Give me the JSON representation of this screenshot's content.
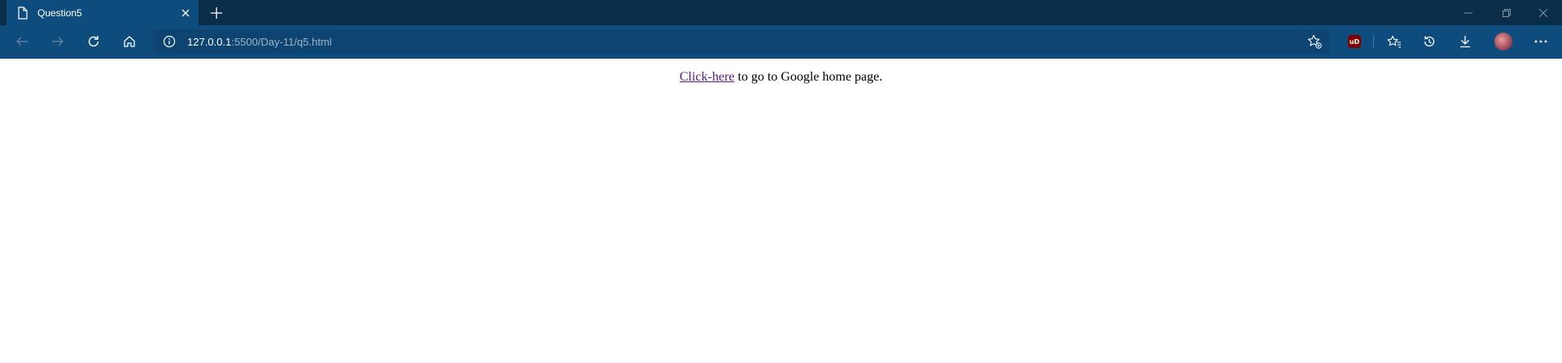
{
  "tab": {
    "title": "Question5",
    "favicon": "page-icon",
    "close": "close-icon"
  },
  "new_tab": "plus-icon",
  "window_controls": [
    "minimize-icon",
    "restore-icon",
    "close-icon"
  ],
  "toolbar": {
    "back": "back-arrow-icon",
    "forward": "forward-arrow-icon",
    "refresh": "refresh-icon",
    "home": "home-icon",
    "site_info": "info-icon",
    "url_host": "127.0.0.1",
    "url_path": ":5500/Day-11/q5.html",
    "add_favorite": "star-add-icon",
    "extension": "ublock-icon",
    "extension_label": "uD",
    "favorites": "favorites-icon",
    "history": "history-icon",
    "downloads": "download-icon",
    "profile": "avatar",
    "menu": "more-icon"
  },
  "page": {
    "link_text": "Click-here",
    "rest_text": " to go to Google home page."
  },
  "colors": {
    "titlebar": "#0a2d4a",
    "active_tab": "#0f4c7e",
    "toolbar": "#0f4c7e",
    "visited_link": "#551a8b"
  }
}
